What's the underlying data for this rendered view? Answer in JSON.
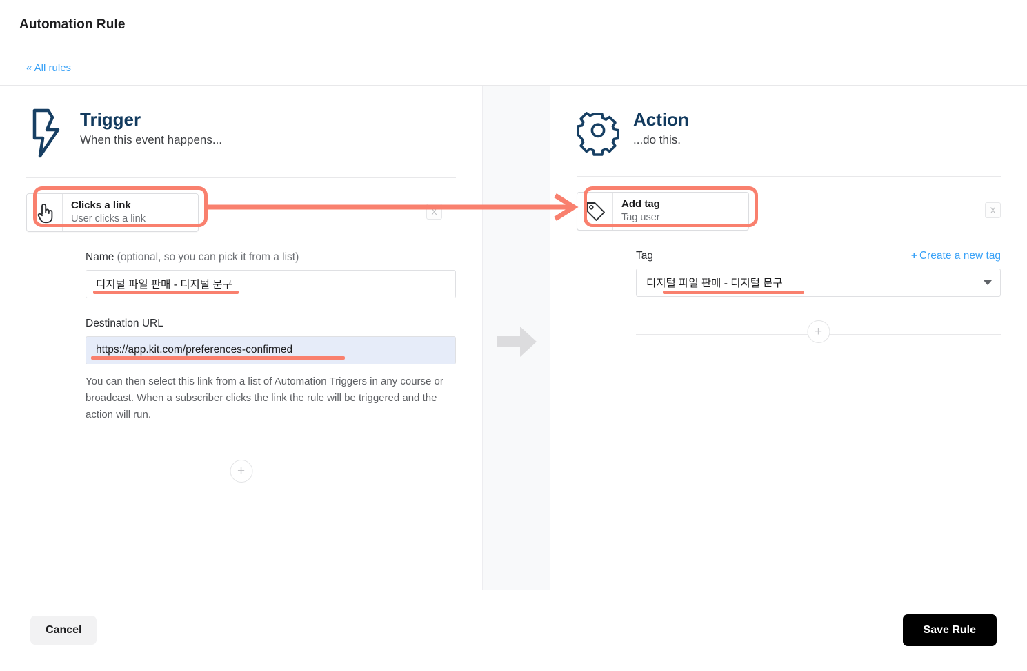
{
  "header": {
    "title": "Automation Rule"
  },
  "breadcrumb": {
    "all_rules_label": "« All rules"
  },
  "trigger": {
    "icon": "lightning-bolt-icon",
    "title": "Trigger",
    "subtitle": "When this event happens...",
    "step": {
      "icon": "pointing-hand-icon",
      "title": "Clicks a link",
      "subtitle": "User clicks a link",
      "delete_label": "X"
    },
    "name_field": {
      "label": "Name",
      "label_optional": " (optional, so you can pick it from a list)",
      "value": "디지털 파일 판매 - 디지털 문구",
      "placeholder": ""
    },
    "url_field": {
      "label": "Destination URL",
      "value": "https://app.kit.com/preferences-confirmed",
      "placeholder": ""
    },
    "help_text": "You can then select this link from a list of Automation Triggers in any course or broadcast. When a subscriber clicks the link the rule will be triggered and the action will run.",
    "add_step_label": "+"
  },
  "center": {
    "flow_arrow_icon": "arrow-right-icon"
  },
  "action": {
    "icon": "gear-icon",
    "title": "Action",
    "subtitle": "...do this.",
    "step": {
      "icon": "tag-icon",
      "title": "Add tag",
      "subtitle": "Tag user",
      "delete_label": "X"
    },
    "tag_field": {
      "label": "Tag",
      "create_link_plus": "+",
      "create_link_label": "Create a new tag",
      "value": "디지털 파일 판매 - 디지털 문구",
      "chevron_icon": "chevron-down-icon"
    },
    "add_step_label": "+"
  },
  "footer": {
    "cancel_label": "Cancel",
    "save_label": "Save Rule"
  },
  "colors": {
    "annotation": "#f9806e",
    "link": "#38a1f7",
    "heading": "#123a5e",
    "primary_button": "#000000",
    "selected_field_bg": "#e6ecf9"
  }
}
